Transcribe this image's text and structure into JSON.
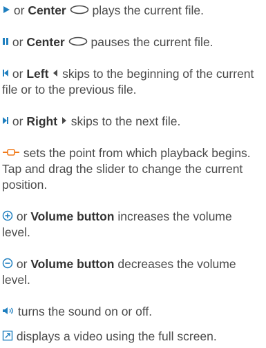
{
  "colors": {
    "text": "#4a4a4a",
    "icon": "#4a4a4a",
    "accent": "#f07a1a",
    "volume_icon": "#1f7fbf"
  },
  "entries": [
    {
      "icon": "play-icon",
      "pre": "or",
      "key": "Center",
      "text": "plays the current file."
    },
    {
      "icon": "pause-icon",
      "pre": "or",
      "key": "Center",
      "text": "pauses the current file."
    },
    {
      "icon": "skip-back-icon",
      "pre": "or",
      "key": "Left",
      "text": "skips to the beginning of the current file or to the previous file."
    },
    {
      "icon": "skip-forward-icon",
      "pre": "or",
      "key": "Right",
      "text": "skips to the next file."
    },
    {
      "icon": "position-slider-icon",
      "text": "sets the point from which playback begins. Tap and drag the slider to change the current position."
    },
    {
      "icon": "volume-up-icon",
      "pre": "or",
      "key": "Volume button",
      "text": "increases the volume level."
    },
    {
      "icon": "volume-down-icon",
      "pre": "or",
      "key": "Volume button",
      "text": "decreases the volume level."
    },
    {
      "icon": "speaker-icon",
      "text": "turns the sound on or off."
    },
    {
      "icon": "full-screen-icon",
      "text": "displays a video using the full screen."
    }
  ]
}
